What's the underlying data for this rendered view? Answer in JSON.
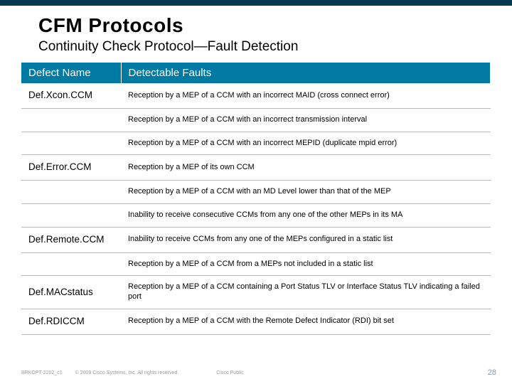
{
  "title": "CFM Protocols",
  "subtitle": "Continuity Check Protocol—Fault Detection",
  "headers": {
    "col1": "Defect Name",
    "col2": "Detectable Faults"
  },
  "rows": [
    {
      "name": "Def.Xcon.CCM",
      "fault": "Reception by a MEP of a CCM with an incorrect MAID (cross connect error)"
    },
    {
      "name": "",
      "fault": "Reception by a MEP of a CCM with an incorrect transmission interval"
    },
    {
      "name": "",
      "fault": "Reception by a MEP of a CCM with an incorrect MEPID (duplicate mpid error)"
    },
    {
      "name": "Def.Error.CCM",
      "fault": "Reception by a MEP of its own CCM"
    },
    {
      "name": "",
      "fault": "Reception by a MEP of a CCM with an MD Level lower than that of the MEP"
    },
    {
      "name": "",
      "fault": "Inability to receive consecutive CCMs from any one of the other MEPs in its MA"
    },
    {
      "name": "Def.Remote.CCM",
      "fault": "Inability to receive CCMs from any one of the MEPs configured in a static list"
    },
    {
      "name": "",
      "fault": "Reception by a MEP of a CCM from a MEPs not included in a static list"
    },
    {
      "name": "Def.MACstatus",
      "fault": "Reception by a MEP of a CCM containing a Port Status TLV or Interface Status TLV indicating a failed port"
    },
    {
      "name": "Def.RDICCM",
      "fault": "Reception by a MEP of a CCM with the Remote Defect Indicator (RDI) bit set"
    }
  ],
  "footer": {
    "code": "BRKOPT-2202_c1",
    "copy": "© 2009 Cisco Systems, Inc. All rights reserved.",
    "pub": "Cisco Public"
  },
  "pagenum": "28"
}
